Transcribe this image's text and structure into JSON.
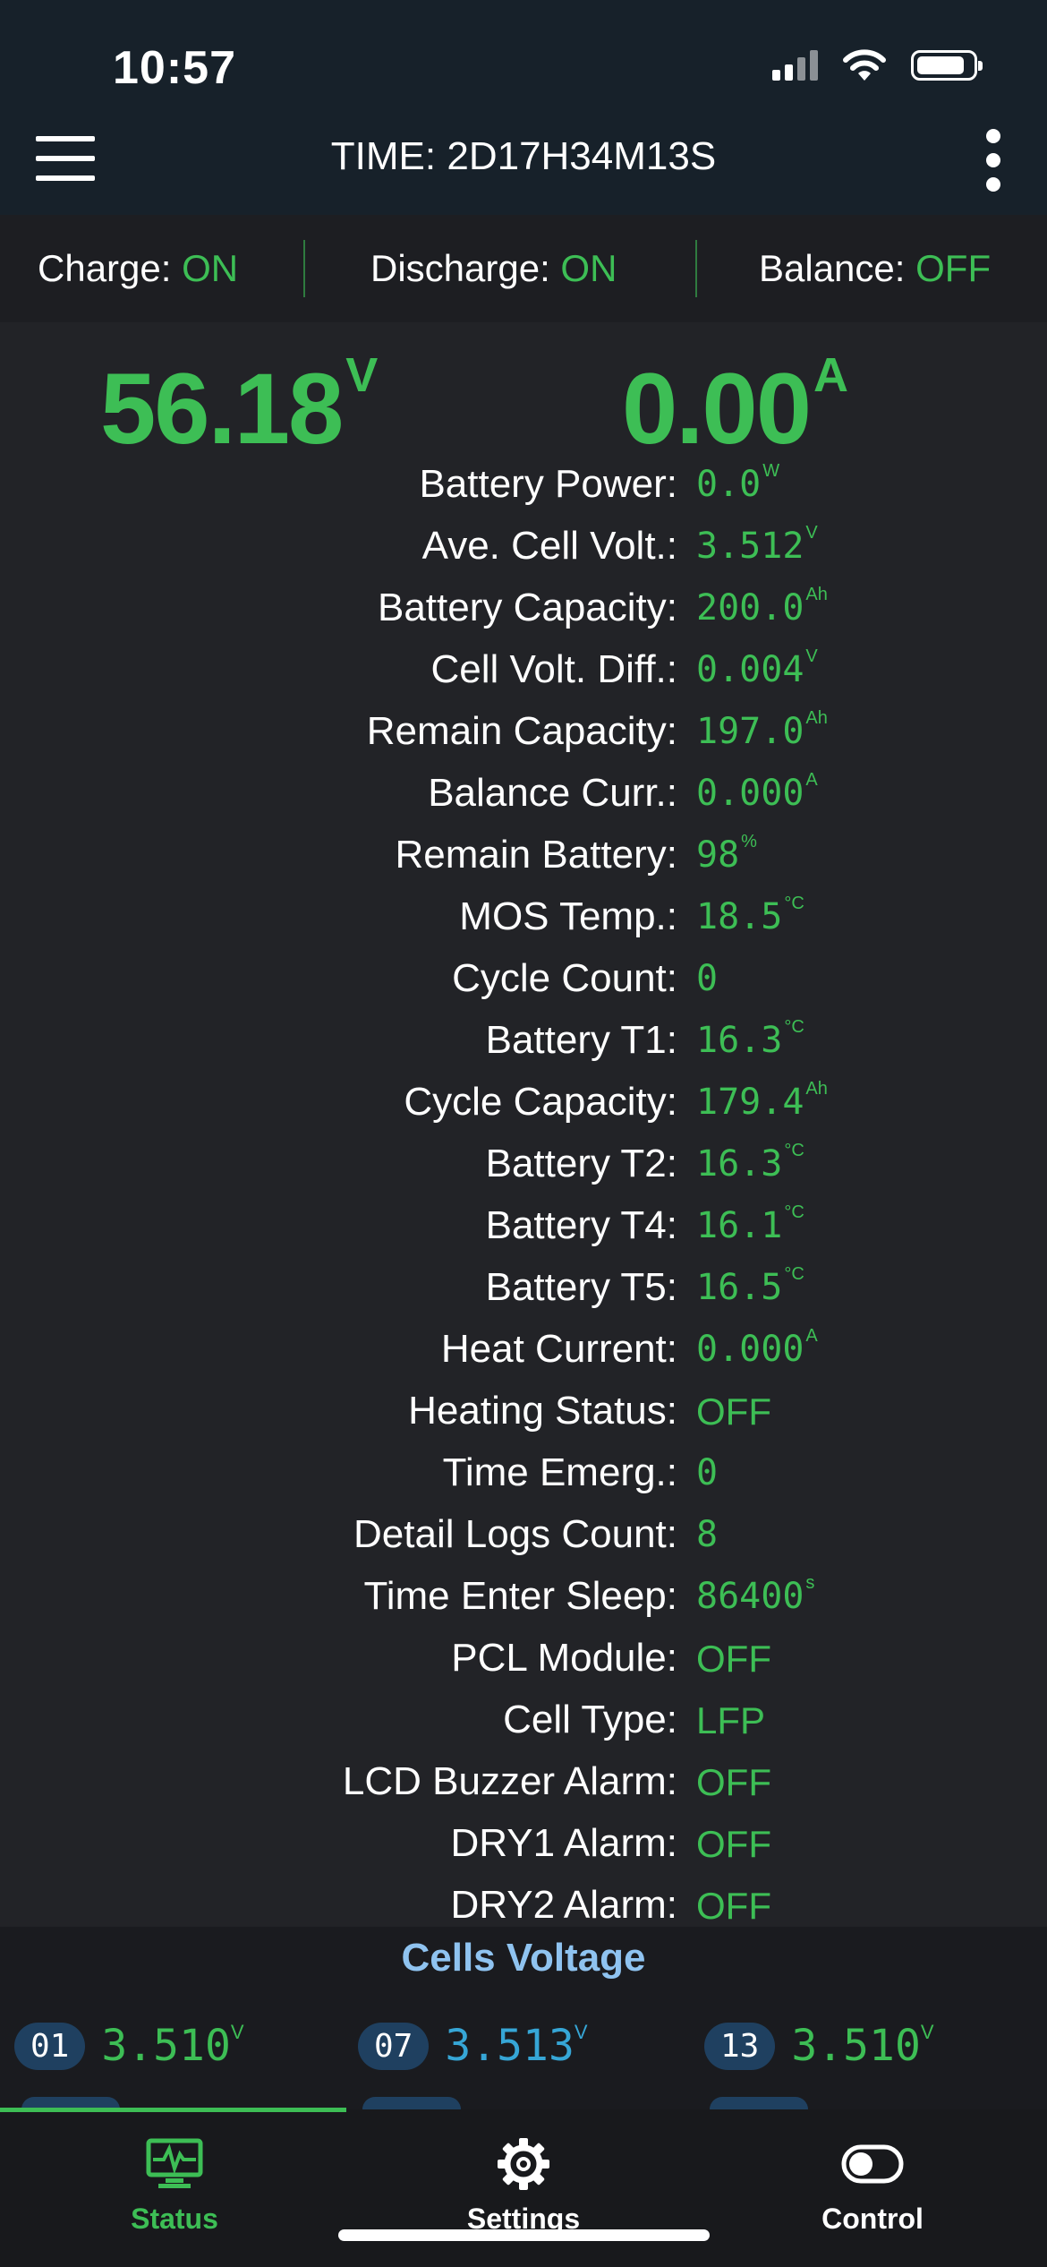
{
  "status_bar": {
    "time": "10:57"
  },
  "header": {
    "title": "TIME: 2D17H34M13S"
  },
  "toggles": [
    {
      "label": "Charge: ",
      "value": "ON"
    },
    {
      "label": "Discharge: ",
      "value": "ON"
    },
    {
      "label": "Balance: ",
      "value": "OFF"
    }
  ],
  "main": {
    "voltage": {
      "value": "56.18",
      "unit": "V"
    },
    "current": {
      "value": "0.00",
      "unit": "A"
    }
  },
  "details": [
    {
      "label": "Battery Power:",
      "value": "0.0",
      "unit": "W"
    },
    {
      "label": "Ave. Cell Volt.:",
      "value": "3.512",
      "unit": "V"
    },
    {
      "label": "Battery Capacity:",
      "value": "200.0",
      "unit": "Ah"
    },
    {
      "label": "Cell Volt. Diff.:",
      "value": "0.004",
      "unit": "V"
    },
    {
      "label": "Remain Capacity:",
      "value": "197.0",
      "unit": "Ah"
    },
    {
      "label": "Balance Curr.:",
      "value": "0.000",
      "unit": "A"
    },
    {
      "label": "Remain Battery:",
      "value": "98",
      "unit": "%"
    },
    {
      "label": "MOS Temp.:",
      "value": "18.5",
      "unit": "°C"
    },
    {
      "label": "Cycle Count:",
      "value": "0",
      "unit": ""
    },
    {
      "label": "Battery T1:",
      "value": "16.3",
      "unit": "°C"
    },
    {
      "label": "Cycle Capacity:",
      "value": "179.4",
      "unit": "Ah"
    },
    {
      "label": "Battery T2:",
      "value": "16.3",
      "unit": "°C"
    },
    {
      "label": "Battery T4:",
      "value": "16.1",
      "unit": "°C"
    },
    {
      "label": "Battery T5:",
      "value": "16.5",
      "unit": "°C"
    },
    {
      "label": "Heat Current:",
      "value": "0.000",
      "unit": "A"
    },
    {
      "label": "Heating Status:",
      "value": "OFF",
      "unit": ""
    },
    {
      "label": "Time Emerg.:",
      "value": "0",
      "unit": ""
    },
    {
      "label": "Detail Logs Count:",
      "value": "8",
      "unit": ""
    },
    {
      "label": "Time Enter Sleep:",
      "value": "86400",
      "unit": "s"
    },
    {
      "label": "PCL Module:",
      "value": "OFF",
      "unit": ""
    },
    {
      "label": "Cell Type:",
      "value": "LFP",
      "unit": ""
    },
    {
      "label": "LCD Buzzer Alarm:",
      "value": "OFF",
      "unit": ""
    },
    {
      "label": "DRY1 Alarm:",
      "value": "OFF",
      "unit": ""
    },
    {
      "label": "DRY2 Alarm:",
      "value": "OFF",
      "unit": ""
    }
  ],
  "cells": {
    "title": "Cells Voltage",
    "items": [
      {
        "index": "01",
        "value": "3.510",
        "unit": "V"
      },
      {
        "index": "07",
        "value": "3.513",
        "unit": "V"
      },
      {
        "index": "13",
        "value": "3.510",
        "unit": "V"
      }
    ]
  },
  "tabs": [
    {
      "label": "Status",
      "icon": "monitor-pulse-icon"
    },
    {
      "label": "Settings",
      "icon": "gear-icon"
    },
    {
      "label": "Control",
      "icon": "toggle-icon"
    }
  ],
  "colors": {
    "accent": "#3dbe55",
    "cell_high": "#36a6d6",
    "cells_title": "#8fc3f0",
    "header_bg": "#17212a",
    "background": "#222327"
  }
}
